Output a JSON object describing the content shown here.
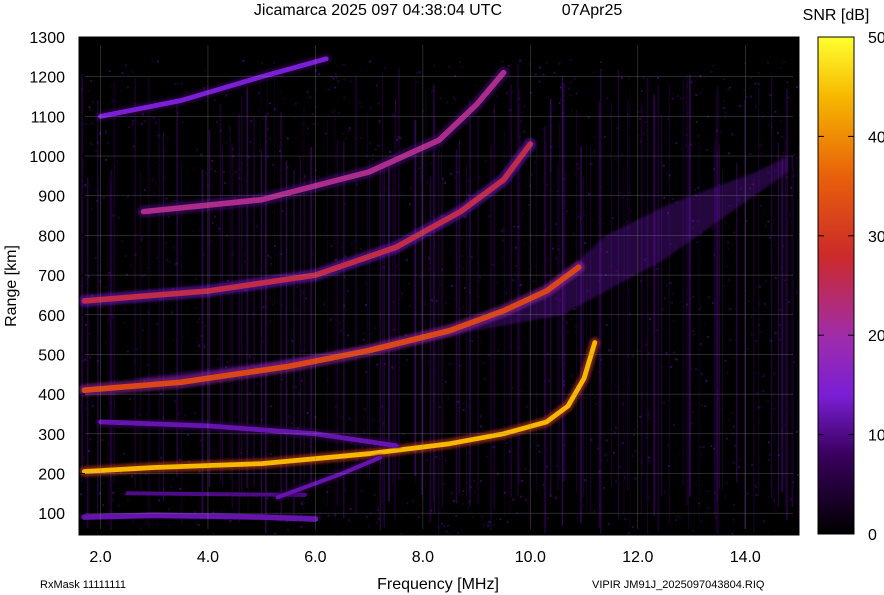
{
  "chart_data": {
    "type": "heatmap",
    "title": "Jicamarca 2025 097 04:38:04 UTC",
    "date_label": "07Apr25",
    "xlabel": "Frequency [MHz]",
    "ylabel": "Range [km]",
    "xlim": [
      1.6,
      15.0
    ],
    "ylim": [
      45,
      1300
    ],
    "x_ticks": [
      2.0,
      4.0,
      6.0,
      8.0,
      10.0,
      12.0,
      14.0
    ],
    "x_tick_labels": [
      "2.0",
      "4.0",
      "6.0",
      "8.0",
      "10.0",
      "12.0",
      "14.0"
    ],
    "y_ticks": [
      100,
      200,
      300,
      400,
      500,
      600,
      700,
      800,
      900,
      1000,
      1100,
      1200,
      1300
    ],
    "y_tick_labels": [
      "100",
      "200",
      "300",
      "400",
      "500",
      "600",
      "700",
      "800",
      "900",
      "1000",
      "1100",
      "1200",
      "1300"
    ],
    "grid": true,
    "colorbar": {
      "label": "SNR [dB]",
      "min": 0,
      "max": 50,
      "ticks": [
        0,
        10,
        20,
        30,
        40,
        50
      ],
      "tick_labels": [
        "0",
        "10",
        "20",
        "30",
        "40",
        "50"
      ],
      "stops": [
        {
          "v": 0,
          "color": "#000000"
        },
        {
          "v": 8,
          "color": "#3a005e"
        },
        {
          "v": 14,
          "color": "#7a1fd6"
        },
        {
          "v": 20,
          "color": "#a02ca8"
        },
        {
          "v": 28,
          "color": "#cc2a2a"
        },
        {
          "v": 36,
          "color": "#e8600a"
        },
        {
          "v": 44,
          "color": "#f6b800"
        },
        {
          "v": 50,
          "color": "#ffff30"
        }
      ]
    },
    "traces": [
      {
        "points": [
          [
            1.7,
            205
          ],
          [
            3.0,
            215
          ],
          [
            5.0,
            225
          ],
          [
            7.0,
            250
          ],
          [
            8.5,
            275
          ],
          [
            9.5,
            300
          ],
          [
            10.3,
            330
          ],
          [
            10.7,
            370
          ],
          [
            11.0,
            440
          ],
          [
            11.2,
            530
          ]
        ],
        "snr": 44,
        "width_km": 12
      },
      {
        "points": [
          [
            2.0,
            330
          ],
          [
            4.0,
            320
          ],
          [
            6.0,
            300
          ],
          [
            7.5,
            270
          ]
        ],
        "snr": 12,
        "width_km": 12
      },
      {
        "points": [
          [
            1.7,
            410
          ],
          [
            3.5,
            430
          ],
          [
            5.5,
            470
          ],
          [
            7.0,
            510
          ],
          [
            8.5,
            560
          ],
          [
            9.5,
            610
          ],
          [
            10.3,
            660
          ],
          [
            10.9,
            720
          ]
        ],
        "snr": 32,
        "width_km": 14
      },
      {
        "points": [
          [
            1.7,
            635
          ],
          [
            4.0,
            660
          ],
          [
            6.0,
            700
          ],
          [
            7.5,
            770
          ],
          [
            8.7,
            860
          ],
          [
            9.5,
            940
          ],
          [
            10.0,
            1030
          ]
        ],
        "snr": 26,
        "width_km": 14
      },
      {
        "points": [
          [
            2.8,
            860
          ],
          [
            5.0,
            890
          ],
          [
            7.0,
            960
          ],
          [
            8.3,
            1040
          ],
          [
            9.0,
            1130
          ],
          [
            9.5,
            1210
          ]
        ],
        "snr": 22,
        "width_km": 14
      },
      {
        "points": [
          [
            2.0,
            1100
          ],
          [
            3.5,
            1140
          ],
          [
            5.0,
            1200
          ],
          [
            6.2,
            1245
          ]
        ],
        "snr": 14,
        "width_km": 12
      },
      {
        "points": [
          [
            1.7,
            90
          ],
          [
            3.0,
            95
          ],
          [
            5.0,
            90
          ],
          [
            6.0,
            85
          ]
        ],
        "snr": 12,
        "width_km": 14
      },
      {
        "points": [
          [
            2.5,
            150
          ],
          [
            4.0,
            148
          ],
          [
            5.8,
            146
          ]
        ],
        "snr": 10,
        "width_km": 10
      },
      {
        "points": [
          [
            5.3,
            140
          ],
          [
            6.5,
            200
          ],
          [
            7.2,
            240
          ]
        ],
        "snr": 12,
        "width_km": 10
      }
    ]
  },
  "footer": {
    "rx_mask": "RxMask 11111111",
    "file_id": "VIPIR  JM91J_2025097043804.RIQ"
  }
}
